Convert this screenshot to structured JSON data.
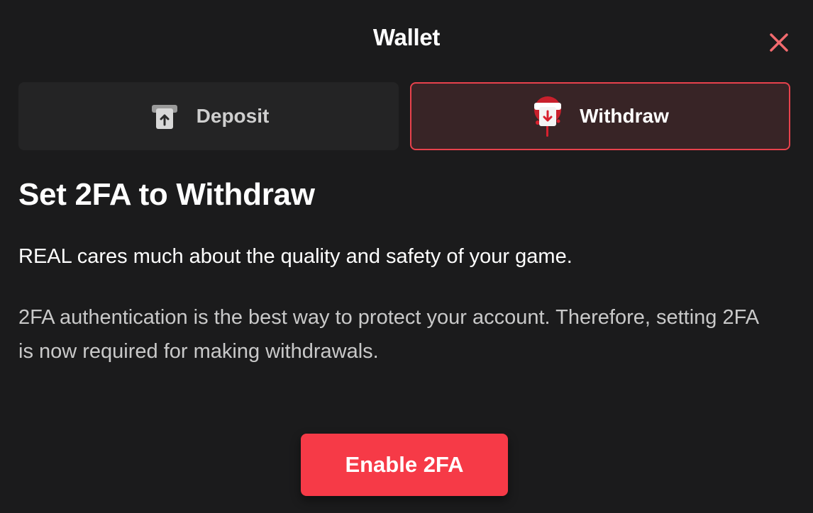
{
  "window": {
    "title": "Wallet",
    "close_icon": "close-icon"
  },
  "tabs": [
    {
      "label": "Deposit",
      "icon": "deposit-icon",
      "active": false
    },
    {
      "label": "Withdraw",
      "icon": "withdraw-icon",
      "active": true
    }
  ],
  "content": {
    "heading": "Set 2FA to Withdraw",
    "lead": "REAL cares much about the quality and safety of your game.",
    "description": "2FA authentication is the best way to protect your account. Therefore, setting 2FA is now required for making withdrawals."
  },
  "action": {
    "button_label": "Enable 2FA"
  },
  "colors": {
    "background": "#1b1b1c",
    "accent": "#f63a47",
    "close": "#f26a6e",
    "active_tab_border": "#e8424c",
    "active_tab_bg": "#382426"
  }
}
